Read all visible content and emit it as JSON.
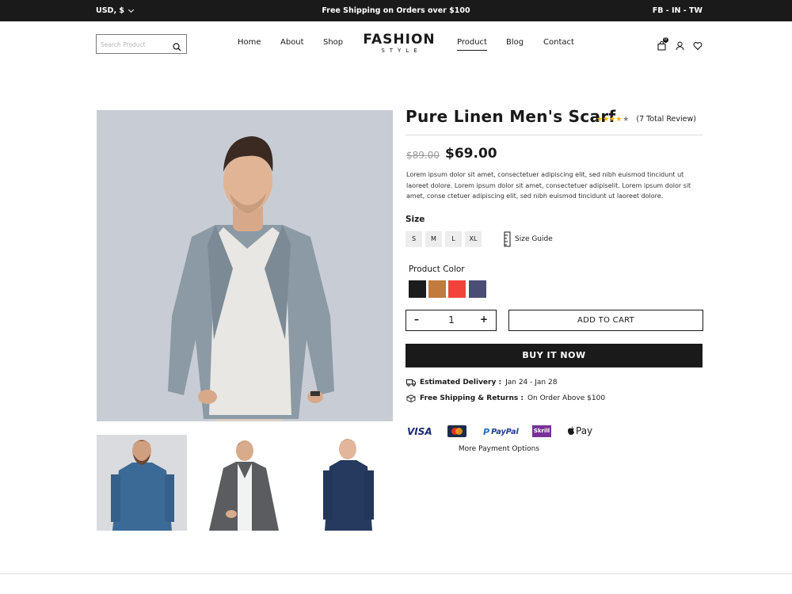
{
  "topbar": {
    "currency": "USD, $",
    "promo": "Free Shipping on Orders over $100",
    "social": "FB - IN - TW"
  },
  "header": {
    "search_placeholder": "Search Product",
    "nav": [
      "Home",
      "About",
      "Shop",
      "Product",
      "Blog",
      "Contact"
    ],
    "active_nav": "Product",
    "logo_main": "FASHION",
    "logo_sub": "STYLE",
    "cart_count": "0",
    "icons": [
      "search-icon",
      "cart-icon",
      "user-icon",
      "heart-icon"
    ]
  },
  "product": {
    "title": "Pure Linen Men's Scarf",
    "rating": 4,
    "rating_max": 5,
    "review_text": "(7 Total Review)",
    "old_price": "$89.00",
    "price": "$69.00",
    "description": "Lorem ipsum dolor sit amet, consectetuer adipiscing elit, sed nibh euismod tincidunt ut laoreet dolore. Lorem ipsum dolor sit amet, consectetuer adipiselit. Lorem ipsum dolor sit amet, conse ctetuer adipiscing elit, sed nibh euismod tincidunt ut laoreet dolore.",
    "size_label": "Size",
    "sizes": [
      "S",
      "M",
      "L",
      "XL"
    ],
    "size_guide": "Size Guide",
    "color_label": "Product Color",
    "colors": [
      "#1c1c1c",
      "#c27a3e",
      "#f0443a",
      "#4a4e74"
    ],
    "quantity": "1",
    "qty_minus": "–",
    "qty_plus": "+",
    "add_to_cart": "ADD TO CART",
    "buy_now": "BUY IT NOW",
    "delivery_label": "Estimated Delivery :",
    "delivery_value": "Jan 24 - Jan 28",
    "shipping_label": "Free Shipping & Returns :",
    "shipping_value": "On Order Above $100",
    "payments": [
      "VISA",
      "MasterCard",
      "PayPal",
      "Skrill",
      "Pay"
    ],
    "more_payments": "More Payment Options"
  },
  "colors": {
    "topbar_bg": "#1a1a1a",
    "main_image_bg": "#c8cdd5",
    "star": "#f5b400"
  }
}
